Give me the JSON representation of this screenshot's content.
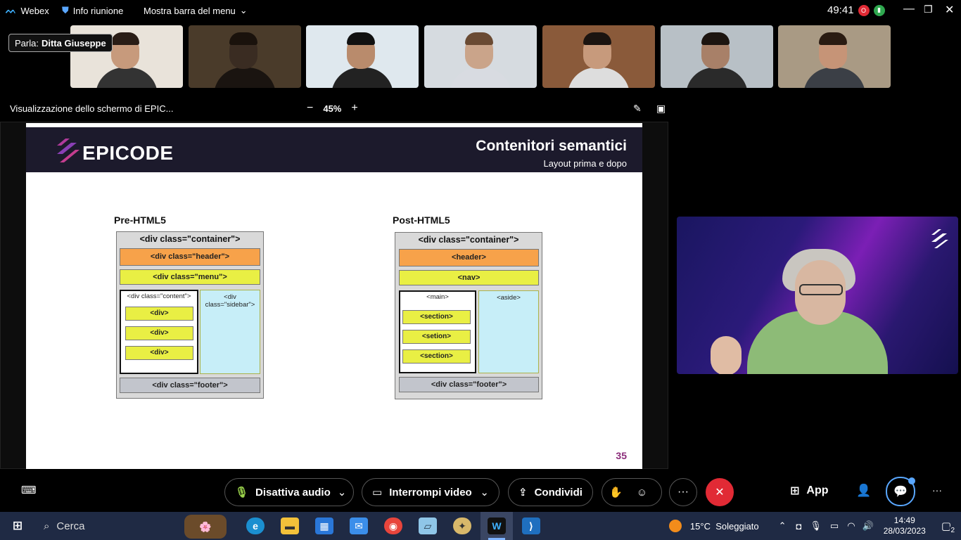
{
  "topbar": {
    "app_name": "Webex",
    "meeting_info": "Info riunione",
    "show_menu": "Mostra barra del menu",
    "timer": "49:41",
    "record_badge": "O"
  },
  "speaker": {
    "prefix": "Parla:",
    "name": "Ditta Giuseppe"
  },
  "participants": [
    {
      "bg": "#e9e3da"
    },
    {
      "bg": "#4a3b2a"
    },
    {
      "bg": "#dfe8ee"
    },
    {
      "bg": "#d6dbe0"
    },
    {
      "bg": "#8a5a3a"
    },
    {
      "bg": "#b8c0c6"
    },
    {
      "bg": "#a99a84"
    }
  ],
  "share": {
    "title": "Visualizzazione dello schermo di EPIC...",
    "zoom": "45%",
    "zoom_minus": "−",
    "zoom_plus": "+"
  },
  "slide": {
    "logo": "EPICODE",
    "title": "Contenitori semantici",
    "subtitle": "Layout prima e dopo",
    "page_number": "35",
    "pre": {
      "heading": "Pre-HTML5",
      "container": "<div class=\"container\">",
      "header": "<div class=\"header\">",
      "menu": "<div class=\"menu\">",
      "content": "<div class=\"content\">",
      "sidebar": "<div class=\"sidebar\">",
      "items": [
        "<div>",
        "<div>",
        "<div>"
      ],
      "footer": "<div class=\"footer\">"
    },
    "post": {
      "heading": "Post-HTML5",
      "container": "<div class=\"container\">",
      "header": "<header>",
      "nav": "<nav>",
      "main": "<main>",
      "aside": "<aside>",
      "items": [
        "<section>",
        "<setion>",
        "<section>"
      ],
      "footer": "<div class=\"footer\">"
    }
  },
  "controls": {
    "mute_label": "Disattiva audio",
    "video_label": "Interrompi video",
    "share_label": "Condividi",
    "apps_label": "App",
    "more": "···",
    "end_icon": "✕"
  },
  "taskbar": {
    "search_placeholder": "Cerca",
    "weather": "15°C  Soleggiato",
    "time": "14:49",
    "date": "28/03/2023",
    "notifications": "2"
  },
  "colors": {
    "end_call": "#e12a35",
    "slide_header": "#1c1a2c",
    "page_number": "#8b2c7a"
  }
}
